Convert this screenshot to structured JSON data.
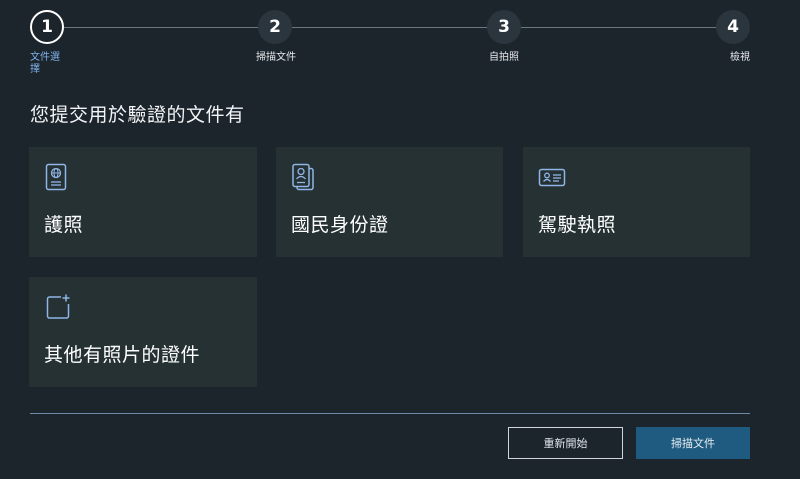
{
  "stepper": {
    "steps": [
      {
        "number": "1",
        "label": "文件選擇"
      },
      {
        "number": "2",
        "label": "掃描文件"
      },
      {
        "number": "3",
        "label": "自拍照"
      },
      {
        "number": "4",
        "label": "檢視"
      }
    ],
    "active_step": 1
  },
  "heading": "您提交用於驗證的文件有",
  "documents": [
    {
      "label": "護照",
      "icon": "passport-icon"
    },
    {
      "label": "國民身份證",
      "icon": "id-document-icon"
    },
    {
      "label": "駕駛執照",
      "icon": "drivers-license-icon"
    },
    {
      "label": "其他有照片的證件",
      "icon": "add-document-icon"
    }
  ],
  "footer": {
    "restart_label": "重新開始",
    "scan_label": "掃描文件"
  },
  "colors": {
    "background": "#1c242c",
    "card": "#263134",
    "accent": "#7fb0ea",
    "primary_button": "#1f5b80"
  }
}
